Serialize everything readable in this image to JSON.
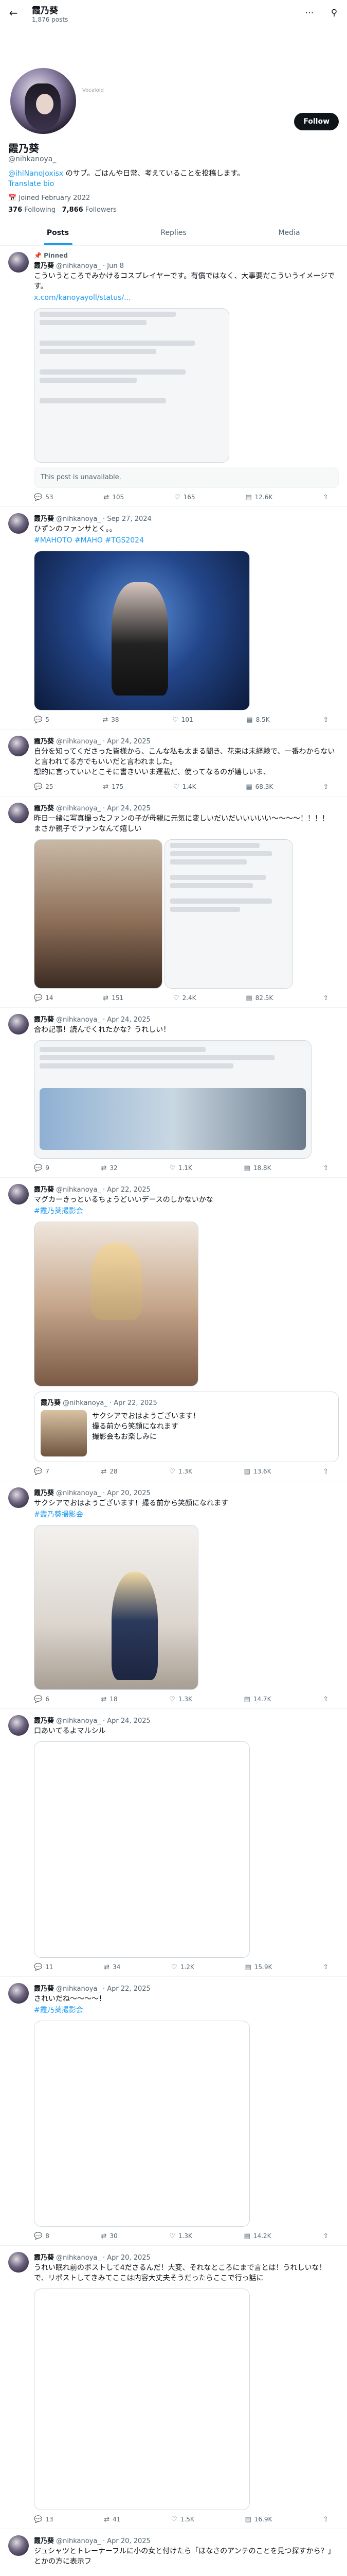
{
  "header": {
    "title": "霞乃葵",
    "subtitle": "1,876 posts"
  },
  "profile": {
    "avatar_caption": "Vocaloid",
    "name": "霞乃葵",
    "handle": "@nihkanoya_",
    "bio_link": "@ihlNanoJoxisx",
    "bio_text": " のサブ。ごはんや日常、考えていることを投稿します。",
    "bio_line2": "Translate bio",
    "joined": "Joined February 2022",
    "following": "376",
    "following_label": "Following",
    "followers": "7,866",
    "followers_label": "Followers",
    "follow_label": "Follow"
  },
  "tabs": [
    "Posts",
    "Replies",
    "Media"
  ],
  "posts": [
    {
      "pinned": "Pinned",
      "name": "霞乃葵",
      "meta": "@nihkanoya_ · Jun 8",
      "text": "こういうところでみかけるコスプレイヤーです。有償ではなく、大事要だこういうイメージです。",
      "link": "x.com/kanoyayoll/status/...",
      "unavailable": "This post is unavailable.",
      "replies": "53",
      "reposts": "105",
      "likes": "165",
      "views": "12.6K"
    },
    {
      "name": "霞乃葵",
      "meta": "@nihkanoya_ · Sep 27, 2024",
      "text": "ひずンのファンサとく。。",
      "tags": "#MAHOTO #MAHO #TGS2024",
      "replies": "5",
      "reposts": "38",
      "likes": "101",
      "views": "8.5K"
    },
    {
      "name": "霞乃葵",
      "meta": "@nihkanoya_ · Apr 24, 2025",
      "text": "自分を知ってくださった皆様から、こんな私も太まる間き、花束は未経験で、一番わからないと言われてる方でもいいだと言われました。\n想的に言っていいとこそに書きいいま運載だ、使ってなるのが嬉しいま、",
      "replies": "25",
      "reposts": "175",
      "likes": "1.4K",
      "views": "68.3K"
    },
    {
      "name": "霞乃葵",
      "meta": "@nihkanoya_ · Apr 24, 2025",
      "text": "昨日一緒に写真撮ったファンの子が母親に元気に変しいだいだいいいいい〜〜〜〜！！！！　まさか親子でファンなんて嬉しい",
      "replies": "14",
      "reposts": "151",
      "likes": "2.4K",
      "views": "82.5K"
    },
    {
      "name": "霞乃葵",
      "meta": "@nihkanoya_ · Apr 24, 2025",
      "text": "合わ記事！読んでくれたかな？うれしい！",
      "replies": "9",
      "reposts": "32",
      "likes": "1.1K",
      "views": "18.8K"
    },
    {
      "name": "霞乃葵",
      "meta": "@nihkanoya_ · Apr 22, 2025",
      "text": "マグカーきっといるちょうどいいデースのしかないかな",
      "tags": "#霞乃葵撮影会",
      "quote_name": "霞乃葵",
      "quote_meta": "@nihkanoya_ · Apr 22, 2025",
      "quote_text": "サクシアでおはようございます！\n撮る前から笑顔になれます\n撮影会もお楽しみに",
      "replies": "7",
      "reposts": "28",
      "likes": "1.3K",
      "views": "13.6K"
    },
    {
      "name": "霞乃葵",
      "meta": "@nihkanoya_ · Apr 20, 2025",
      "text": "サクシアでおはようございます！撮る前から笑顔になれます",
      "tags": "#霞乃葵撮影会",
      "replies": "6",
      "reposts": "18",
      "likes": "1.3K",
      "views": "14.7K"
    },
    {
      "name": "霞乃葵",
      "meta": "@nihkanoya_ · Apr 24, 2025",
      "text": "口あいてるよマルシル",
      "replies": "11",
      "reposts": "34",
      "likes": "1.2K",
      "views": "15.9K"
    },
    {
      "name": "霞乃葵",
      "meta": "@nihkanoya_ · Apr 22, 2025",
      "text": "されいだね〜〜〜〜！",
      "tags": "#霞乃葵撮影会",
      "replies": "8",
      "reposts": "30",
      "likes": "1.3K",
      "views": "14.2K"
    },
    {
      "name": "霞乃葵",
      "meta": "@nihkanoya_ · Apr 20, 2025",
      "text": "うれい眠れ前のポストして4ださるんだ！大変、それなところにまで言とは！うれしいな！で、リポストしてきみてここは内容大丈夫そうだったらここで行っ話に",
      "replies": "13",
      "reposts": "41",
      "likes": "1.5K",
      "views": "16.9K"
    },
    {
      "name": "霞乃葵",
      "meta": "@nihkanoya_ · Apr 20, 2025",
      "text": "ジュシャツとトレーナーフルに小の女と付けたら「ほなさのアンテのことを見つ探すから？」とかの方に表示フ"
    }
  ]
}
